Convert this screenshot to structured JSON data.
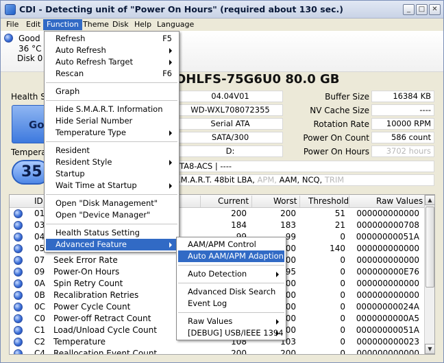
{
  "window": {
    "title": "CDI - Detecting unit of \"Power On Hours\" (required about 130 sec.)",
    "controls": {
      "minimize": "_",
      "maximize": "□",
      "close": "✕"
    }
  },
  "menubar": [
    "File",
    "Edit",
    "Function",
    "Theme",
    "Disk",
    "Help",
    "Language"
  ],
  "disk_status": {
    "health_word": "Good",
    "temp": "36 °C",
    "disk": "Disk 0"
  },
  "drive": {
    "model_fragment": "OHLFS-75G6U0  80.0 GB",
    "health_label_fragment": "Health S",
    "health_value_fragment": "Go",
    "temperature_label_fragment": "Tempera",
    "temperature_value_fragment": "35",
    "standard_fragment": "TA8-ACS | ----",
    "features": {
      "prefix": ".M.A.R.T.  48bit LBA,",
      "apm": "APM,",
      "aam": "AAM,",
      "ncq": "NCQ,",
      "trim": "TRIM"
    }
  },
  "info_left": [
    "04.04V01",
    "WD-WXL708072355",
    "Serial ATA",
    "SATA/300",
    "D:"
  ],
  "info_right": [
    {
      "label": "Buffer Size",
      "value": "16384 KB",
      "dim": false
    },
    {
      "label": "NV Cache Size",
      "value": "----",
      "dim": false
    },
    {
      "label": "Rotation Rate",
      "value": "10000 RPM",
      "dim": false
    },
    {
      "label": "Power On Count",
      "value": "586 count",
      "dim": false
    },
    {
      "label": "Power On Hours",
      "value": "3702 hours",
      "dim": true
    }
  ],
  "table": {
    "headers": {
      "id": "ID",
      "current": "Current",
      "worst": "Worst",
      "threshold": "Threshold",
      "raw": "Raw Values"
    },
    "rows": [
      {
        "id": "01",
        "name": "",
        "current": "200",
        "worst": "200",
        "threshold": "51",
        "raw": "000000000000"
      },
      {
        "id": "03",
        "name": "",
        "current": "184",
        "worst": "183",
        "threshold": "21",
        "raw": "000000000708"
      },
      {
        "id": "04",
        "name": "",
        "current": "99",
        "worst": "99",
        "threshold": "0",
        "raw": "00000000051A"
      },
      {
        "id": "05",
        "name": "",
        "current": "200",
        "worst": "200",
        "threshold": "140",
        "raw": "000000000000"
      },
      {
        "id": "07",
        "name": "Seek Error Rate",
        "current": "",
        "worst": "200",
        "threshold": "0",
        "raw": "000000000000"
      },
      {
        "id": "09",
        "name": "Power-On Hours",
        "current": "",
        "worst": "95",
        "threshold": "0",
        "raw": "000000000E76"
      },
      {
        "id": "0A",
        "name": "Spin Retry Count",
        "current": "",
        "worst": "100",
        "threshold": "0",
        "raw": "000000000000"
      },
      {
        "id": "0B",
        "name": "Recalibration Retries",
        "current": "",
        "worst": "100",
        "threshold": "0",
        "raw": "000000000000"
      },
      {
        "id": "0C",
        "name": "Power Cycle Count",
        "current": "",
        "worst": "100",
        "threshold": "0",
        "raw": "00000000024A"
      },
      {
        "id": "C0",
        "name": "Power-off Retract Count",
        "current": "",
        "worst": "200",
        "threshold": "0",
        "raw": "0000000000A5"
      },
      {
        "id": "C1",
        "name": "Load/Unload Cycle Count",
        "current": "",
        "worst": "200",
        "threshold": "0",
        "raw": "00000000051A"
      },
      {
        "id": "C2",
        "name": "Temperature",
        "current": "108",
        "worst": "103",
        "threshold": "0",
        "raw": "000000000023"
      },
      {
        "id": "C4",
        "name": "Reallocation Event Count",
        "current": "200",
        "worst": "200",
        "threshold": "0",
        "raw": "000000000000"
      }
    ]
  },
  "function_menu": [
    {
      "label": "Refresh",
      "shortcut": "F5",
      "submenu": false
    },
    {
      "label": "Auto Refresh",
      "shortcut": "",
      "submenu": true
    },
    {
      "label": "Auto Refresh Target",
      "shortcut": "",
      "submenu": true
    },
    {
      "label": "Rescan",
      "shortcut": "F6",
      "submenu": false
    },
    {
      "label": "Graph",
      "shortcut": "",
      "submenu": false
    },
    {
      "label": "Hide S.M.A.R.T. Information",
      "shortcut": "",
      "submenu": false
    },
    {
      "label": "Hide Serial Number",
      "shortcut": "",
      "submenu": false
    },
    {
      "label": "Temperature Type",
      "shortcut": "",
      "submenu": true
    },
    {
      "label": "Resident",
      "shortcut": "",
      "submenu": false
    },
    {
      "label": "Resident Style",
      "shortcut": "",
      "submenu": true
    },
    {
      "label": "Startup",
      "shortcut": "",
      "submenu": false
    },
    {
      "label": "Wait Time at Startup",
      "shortcut": "",
      "submenu": true
    },
    {
      "label": "Open \"Disk Management\"",
      "shortcut": "",
      "submenu": false
    },
    {
      "label": "Open \"Device Manager\"",
      "shortcut": "",
      "submenu": false
    },
    {
      "label": "Health Status Setting",
      "shortcut": "",
      "submenu": false
    },
    {
      "label": "Advanced Feature",
      "shortcut": "",
      "submenu": true
    }
  ],
  "advanced_menu": [
    {
      "label": "AAM/APM Control",
      "submenu": false
    },
    {
      "label": "Auto AAM/APM Adaption",
      "submenu": false
    },
    {
      "label": "Auto Detection",
      "submenu": true
    },
    {
      "label": "Advanced Disk Search",
      "submenu": false
    },
    {
      "label": "Event Log",
      "submenu": false
    },
    {
      "label": "Raw Values",
      "submenu": true
    },
    {
      "label": "[DEBUG] USB/IEEE 1394",
      "submenu": true
    }
  ],
  "colors": {
    "highlight": "#316ac5",
    "good_blue": "#3b6fd8"
  }
}
